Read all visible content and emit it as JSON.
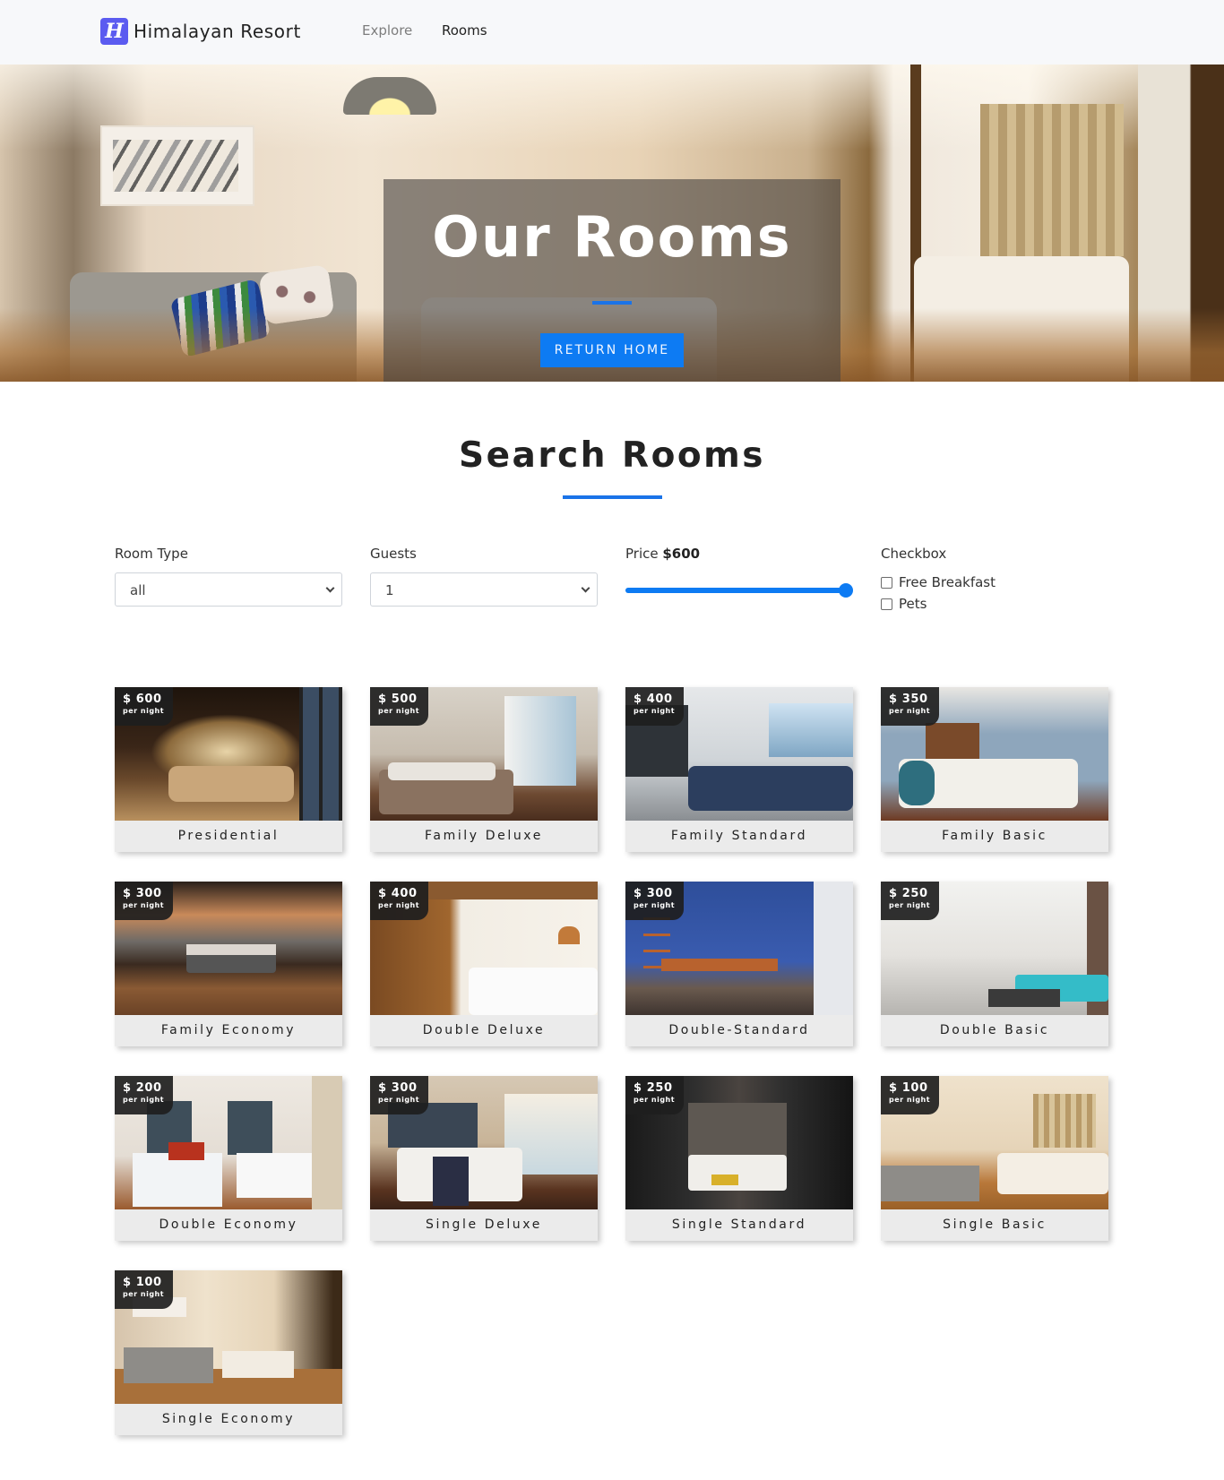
{
  "navbar": {
    "brand_letter": "H",
    "brand_name": "Himalayan Resort",
    "links": [
      {
        "label": "Explore"
      },
      {
        "label": "Rooms"
      }
    ]
  },
  "hero": {
    "title": "Our Rooms",
    "button_label": "RETURN HOME"
  },
  "search": {
    "title": "Search Rooms",
    "room_type": {
      "label": "Room Type",
      "value": "all"
    },
    "guests": {
      "label": "Guests",
      "value": "1"
    },
    "price": {
      "label": "Price",
      "value_text": "$600",
      "min": 0,
      "max": 600,
      "value": 600
    },
    "checkbox": {
      "label": "Checkbox",
      "options": [
        {
          "label": "Free Breakfast",
          "checked": false
        },
        {
          "label": "Pets",
          "checked": false
        }
      ]
    }
  },
  "rooms": [
    {
      "name": "Presidential",
      "price": "$ 600",
      "unit": "per night"
    },
    {
      "name": "Family Deluxe",
      "price": "$ 500",
      "unit": "per night"
    },
    {
      "name": "Family Standard",
      "price": "$ 400",
      "unit": "per night"
    },
    {
      "name": "Family Basic",
      "price": "$ 350",
      "unit": "per night"
    },
    {
      "name": "Family Economy",
      "price": "$ 300",
      "unit": "per night"
    },
    {
      "name": "Double Deluxe",
      "price": "$ 400",
      "unit": "per night"
    },
    {
      "name": "Double-Standard",
      "price": "$ 300",
      "unit": "per night"
    },
    {
      "name": "Double Basic",
      "price": "$ 250",
      "unit": "per night"
    },
    {
      "name": "Double Economy",
      "price": "$ 200",
      "unit": "per night"
    },
    {
      "name": "Single Deluxe",
      "price": "$ 300",
      "unit": "per night"
    },
    {
      "name": "Single Standard",
      "price": "$ 250",
      "unit": "per night"
    },
    {
      "name": "Single Basic",
      "price": "$ 100",
      "unit": "per night"
    },
    {
      "name": "Single Economy",
      "price": "$ 100",
      "unit": "per night"
    }
  ],
  "colors": {
    "accent": "#0d7bf3",
    "brand": "#5b5bf0",
    "navbar_bg": "#f7f8fa",
    "card_bg": "#ebebeb"
  }
}
